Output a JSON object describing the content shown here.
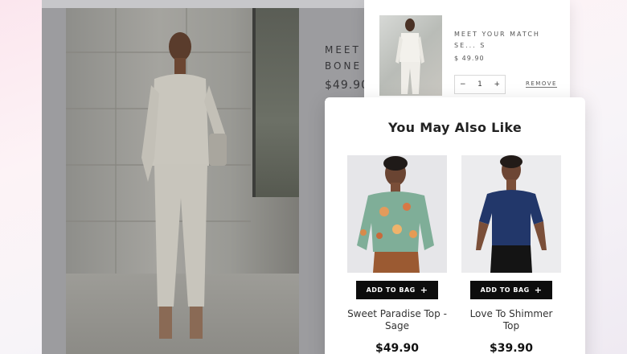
{
  "product": {
    "title": "MEET\nBONE",
    "price": "$49.90"
  },
  "cart": {
    "item_name": "MEET YOUR MATCH SE... S",
    "item_price": "$ 49.90",
    "quantity": "1",
    "minus_label": "−",
    "plus_label": "+",
    "remove_label": "REMOVE"
  },
  "recommendations": {
    "title": "You May Also Like",
    "items": [
      {
        "button_label": "ADD TO BAG",
        "button_plus": "+",
        "name": "Sweet Paradise Top - Sage",
        "price": "$49.90"
      },
      {
        "button_label": "ADD TO BAG",
        "button_plus": "+",
        "name": "Love To Shimmer Top",
        "price": "$39.90"
      }
    ]
  },
  "colors": {
    "overlay_page": "#9c9c9f",
    "button_black": "#0d0d0d",
    "panel_white": "#ffffff"
  }
}
